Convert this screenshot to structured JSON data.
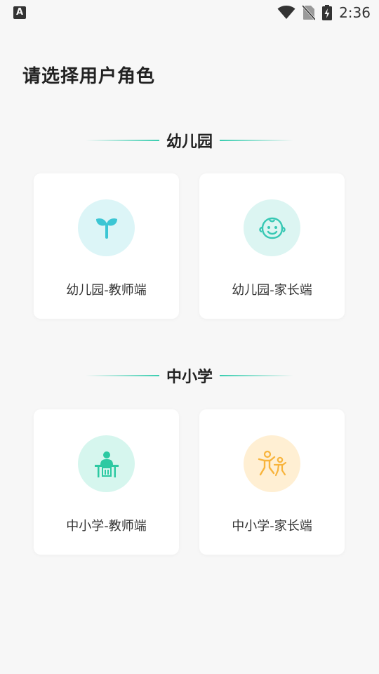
{
  "status_bar": {
    "left_icon": "A",
    "time": "2:36",
    "icons": [
      "wifi-icon",
      "no-sim-icon",
      "battery-charging-icon"
    ]
  },
  "page": {
    "title": "请选择用户角色"
  },
  "sections": [
    {
      "title": "幼儿园",
      "cards": [
        {
          "label": "幼儿园-教师端",
          "icon": "sprout-icon",
          "icon_bg": "#dcf5f7",
          "icon_color": "#3cc6d4"
        },
        {
          "label": "幼儿园-家长端",
          "icon": "baby-face-icon",
          "icon_bg": "#dcf5f2",
          "icon_color": "#37c8b4"
        }
      ]
    },
    {
      "title": "中小学",
      "cards": [
        {
          "label": "中小学-教师端",
          "icon": "teacher-desk-icon",
          "icon_bg": "#d6f6ee",
          "icon_color": "#2dc9a2"
        },
        {
          "label": "中小学-家长端",
          "icon": "parent-child-icon",
          "icon_bg": "#ffefd3",
          "icon_color": "#f8b43c"
        }
      ]
    }
  ],
  "colors": {
    "accent_line": "#38cdaf",
    "background": "#f7f7f7",
    "card": "#ffffff"
  }
}
